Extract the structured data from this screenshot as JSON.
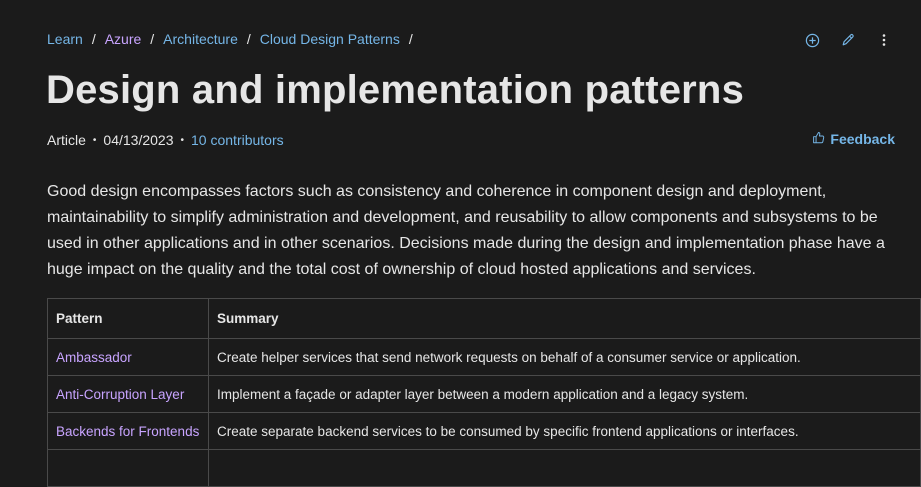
{
  "breadcrumb": [
    {
      "label": "Learn",
      "visited": false
    },
    {
      "label": "Azure",
      "visited": true
    },
    {
      "label": "Architecture",
      "visited": false
    },
    {
      "label": "Cloud Design Patterns",
      "visited": false
    }
  ],
  "breadcrumb_separator": "/",
  "toolbar": {
    "icons": [
      "add-circle-icon",
      "edit-pencil-icon",
      "more-vertical-icon"
    ]
  },
  "page_title": "Design and implementation patterns",
  "meta": {
    "type": "Article",
    "date": "04/13/2023",
    "contributors": "10 contributors",
    "separator": "•"
  },
  "feedback_label": "Feedback",
  "intro": "Good design encompasses factors such as consistency and coherence in component design and deployment, maintainability to simplify administration and development, and reusability to allow components and subsystems to be used in other applications and in other scenarios. Decisions made during the design and implementation phase have a huge impact on the quality and the total cost of ownership of cloud hosted applications and services.",
  "table": {
    "headers": [
      "Pattern",
      "Summary"
    ],
    "rows": [
      {
        "pattern": "Ambassador",
        "summary": "Create helper services that send network requests on behalf of a consumer service or application."
      },
      {
        "pattern": "Anti-Corruption Layer",
        "summary": "Implement a façade or adapter layer between a modern application and a legacy system."
      },
      {
        "pattern": "Backends for Frontends",
        "summary": "Create separate backend services to be consumed by specific frontend applications or interfaces."
      }
    ]
  },
  "colors": {
    "background": "#1b1b1b",
    "text": "#e6e6e6",
    "link": "#75b6e7",
    "visited_link": "#c8a4ff",
    "border": "#4a4a4a"
  }
}
